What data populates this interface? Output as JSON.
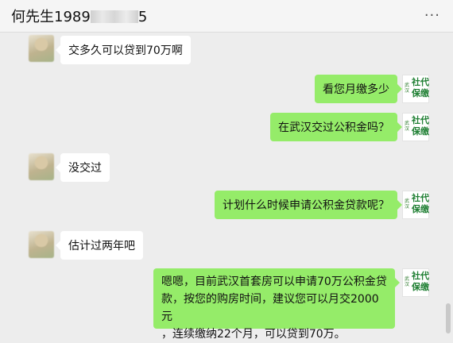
{
  "header": {
    "title_prefix": "何先生1989",
    "title_suffix": "5",
    "more_label": "···"
  },
  "agent_logo": {
    "small_text": "武汉",
    "big_text": "社代保缴"
  },
  "messages": [
    {
      "side": "left",
      "text": "交多久可以贷到70万啊"
    },
    {
      "side": "right",
      "text": "看您月缴多少"
    },
    {
      "side": "right",
      "text": "在武汉交过公积金吗？"
    },
    {
      "side": "left",
      "text": "没交过"
    },
    {
      "side": "right",
      "text": "计划什么时候申请公积金贷款呢？"
    },
    {
      "side": "left",
      "text": "估计过两年吧"
    },
    {
      "side": "right",
      "lines": [
        "嗯嗯，目前武汉首套房可以申请70万公积金贷",
        "款，按您的购房时间，建议您可以月交2000元",
        "，连续缴纳22个月，可以贷到70万。"
      ]
    }
  ],
  "colors": {
    "chat_background": "#ededed",
    "my_bubble": "#95ec69",
    "other_bubble": "#ffffff",
    "logo_green": "#1f7f33"
  }
}
